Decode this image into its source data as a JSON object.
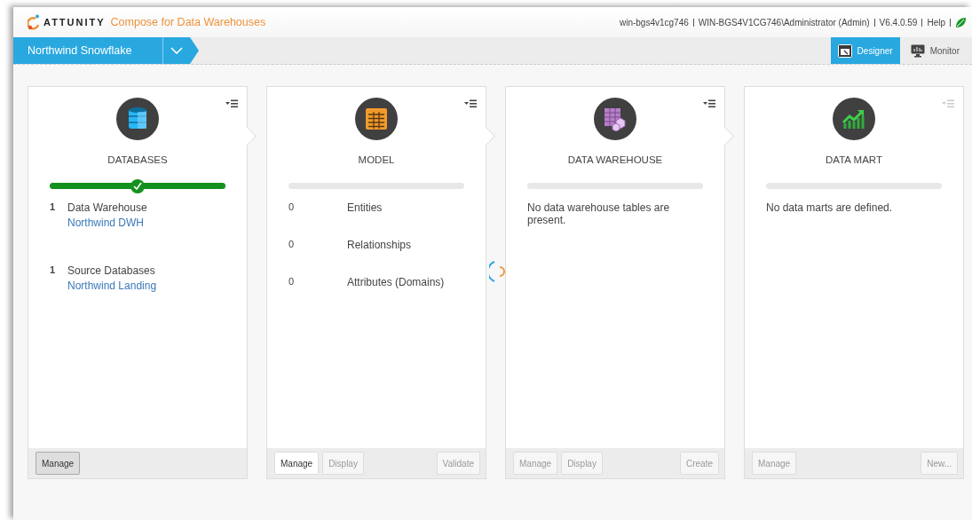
{
  "header": {
    "brand": "ATTUNITY",
    "product": "Compose for Data Warehouses",
    "info": [
      "win-bgs4v1cg746",
      "WIN-BGS4V1CG746\\Administrator (Admin)",
      "V6.4.0.59",
      "Help"
    ]
  },
  "project": {
    "name": "Northwind Snowflake"
  },
  "views": [
    {
      "label": "Designer",
      "selected": true,
      "kind": "designer"
    },
    {
      "label": "Monitor",
      "selected": false,
      "kind": "monitor"
    }
  ],
  "panels": [
    {
      "title": "DATABASES",
      "kind": "database",
      "menu_disabled": false,
      "progress": {
        "level": 1
      },
      "items": [
        {
          "count": "1",
          "label": "Data Warehouse",
          "link": "Northwind DWH"
        },
        {
          "count": "1",
          "label": "Source Databases",
          "link": "Northwind Landing"
        }
      ],
      "buttons": [
        {
          "label": "Manage",
          "disabled": false,
          "hover": true
        }
      ]
    },
    {
      "title": "MODEL",
      "kind": "model",
      "menu_disabled": false,
      "progress": {
        "level": 0
      },
      "items": [
        {
          "count": "0",
          "label": "Entities"
        },
        {
          "count": "0",
          "label": "Relationships"
        },
        {
          "count": "0",
          "label": "Attributes (Domains)"
        }
      ],
      "buttons": [
        {
          "label": "Manage",
          "disabled": false,
          "hover": false
        },
        {
          "label": "Display",
          "disabled": true,
          "hover": false
        },
        {
          "label": "Validate",
          "disabled": true,
          "hover": false
        }
      ]
    },
    {
      "title": "DATA WAREHOUSE",
      "kind": "warehouse",
      "menu_disabled": false,
      "progress": {
        "level": 0
      },
      "message": "No data warehouse tables are present.",
      "buttons": [
        {
          "label": "Manage",
          "disabled": true,
          "hover": false
        },
        {
          "label": "Display",
          "disabled": true,
          "hover": false
        },
        {
          "label": "Create",
          "disabled": true,
          "hover": false
        }
      ]
    },
    {
      "title": "DATA MART",
      "kind": "mart",
      "menu_disabled": true,
      "progress": {
        "level": 0
      },
      "message": "No data marts are defined.",
      "buttons": [
        {
          "label": "Manage",
          "disabled": true,
          "hover": false
        },
        {
          "label": "New...",
          "disabled": true,
          "hover": false
        }
      ]
    }
  ]
}
